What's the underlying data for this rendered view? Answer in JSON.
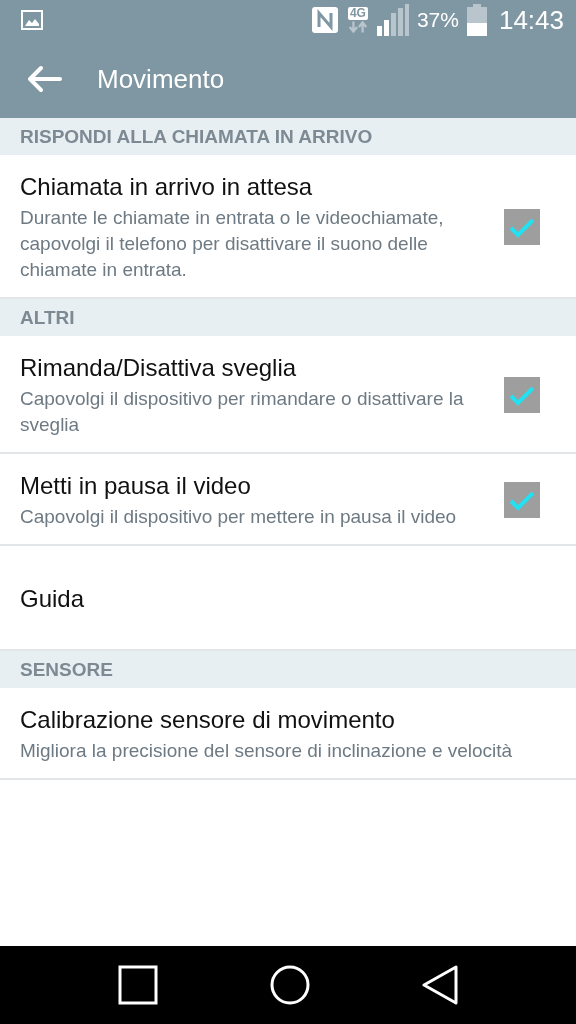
{
  "status_bar": {
    "battery_text": "37%",
    "time": "14:43",
    "network": "4G"
  },
  "app_bar": {
    "title": "Movimento"
  },
  "sections": [
    {
      "header": "RISPONDI ALLA CHIAMATA IN ARRIVO",
      "items": [
        {
          "kind": "checkbox",
          "title": "Chiamata in arrivo in attesa",
          "summary": "Durante le chiamate in entrata o le videochiamate, capovolgi il telefono per disattivare il suono delle chiamate in entrata.",
          "checked": true
        }
      ]
    },
    {
      "header": "ALTRI",
      "items": [
        {
          "kind": "checkbox",
          "title": "Rimanda/Disattiva sveglia",
          "summary": "Capovolgi il dispositivo per rimandare o disattivare la sveglia",
          "checked": true
        },
        {
          "kind": "checkbox",
          "title": "Metti in pausa il video",
          "summary": "Capovolgi il dispositivo per mettere in pausa il video",
          "checked": true
        },
        {
          "kind": "plain",
          "title": "Guida"
        }
      ]
    },
    {
      "header": "SENSORE",
      "items": [
        {
          "kind": "plain",
          "title": "Calibrazione sensore di movimento",
          "summary": "Migliora la precisione del sensore di inclinazione e velocità"
        }
      ]
    }
  ]
}
